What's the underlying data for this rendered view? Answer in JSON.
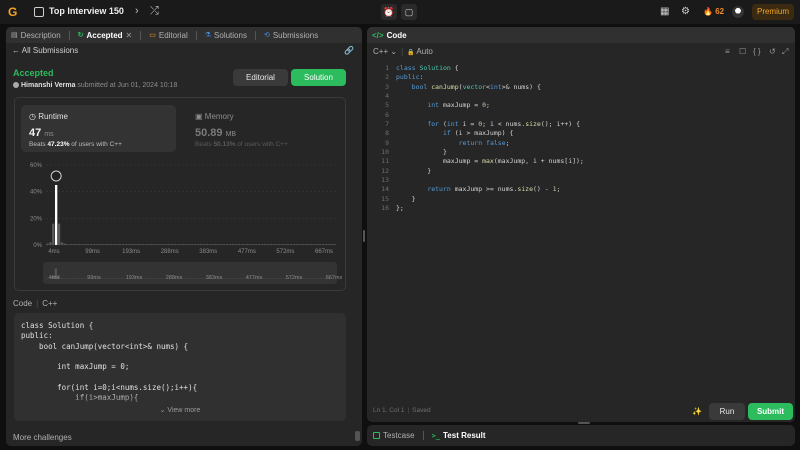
{
  "topbar": {
    "logo_glyph": "G",
    "list_title": "Top Interview 150",
    "prev_glyph": "‹",
    "next_glyph": "›",
    "shuffle_glyph": "⤮",
    "timer_glyph": "⏰",
    "notes_glyph": "▢",
    "layout_glyph": "▦",
    "settings_glyph": "⚙",
    "streak_count": "62",
    "fire_glyph": "🔥",
    "premium_label": "Premium"
  },
  "left_panel": {
    "tabs": [
      {
        "icon": "▤",
        "label": "Description"
      },
      {
        "icon": "↻",
        "label": "Accepted",
        "close": "✕"
      },
      {
        "icon": "▭",
        "label": "Editorial"
      },
      {
        "icon": "⚗",
        "label": "Solutions"
      },
      {
        "icon": "⟲",
        "label": "Submissions"
      }
    ],
    "back_label": "All Submissions",
    "back_glyph": "←",
    "link_glyph": "🔗",
    "status": "Accepted",
    "submitter_name": "Himanshi Verma",
    "submitted_text": " submitted at Jun 01, 2024 10:18",
    "editorial_button": "Editorial",
    "solution_button": "Solution",
    "runtime": {
      "title": "Runtime",
      "value": "47",
      "unit": "ms",
      "beats_prefix": "Beats ",
      "beats_pct": "47.23%",
      "beats_suffix": " of users with C++"
    },
    "memory": {
      "title": "Memory",
      "value": "50.89",
      "unit": "MB",
      "beats_prefix": "Beats ",
      "beats_pct": "50.13%",
      "beats_suffix": " of users with C++"
    },
    "code_label": "Code",
    "code_lang": "C++",
    "code_preview": "class Solution {\npublic:\n    bool canJump(vector<int>& nums) {\n\n        int maxJump = 0;\n\n        for(int i=0;i<nums.size();i++){\n            if(i>maxJump){",
    "view_more": "View more",
    "more_challenges": "More challenges"
  },
  "chart_data": {
    "type": "bar",
    "title": "",
    "ylabel": "",
    "ylim": [
      0,
      60
    ],
    "y_ticks": [
      "0%",
      "20%",
      "40%",
      "60%"
    ],
    "x_ticks": [
      "4ms",
      "99ms",
      "193ms",
      "288ms",
      "383ms",
      "477ms",
      "572ms",
      "667ms"
    ],
    "range_ticks": [
      "4ms",
      "99ms",
      "193ms",
      "288ms",
      "383ms",
      "477ms",
      "572ms",
      "667ms"
    ],
    "bars": [
      1,
      2,
      16,
      45,
      16,
      2,
      1,
      0.6,
      0.6,
      0.6,
      0.6,
      0.6,
      0.6,
      0.6,
      0.6,
      0.6,
      0.6,
      0.6,
      0.6,
      0.6,
      0.6,
      0.6,
      0.6,
      0.6,
      0.6,
      0.6,
      0.6,
      0.6,
      0.6,
      0.6,
      0.6,
      0.6,
      0.6,
      0.6,
      0.6,
      0.6,
      0.6,
      0.6,
      0.6,
      0.6,
      0.6,
      0.6,
      0.6,
      0.6,
      0.6,
      0.6,
      0.6,
      0.6,
      0.6,
      0.6,
      0.6,
      0.6,
      0.6,
      0.6,
      0.6,
      0.6,
      0.6,
      0.6,
      0.6,
      0.6,
      0.6,
      0.6,
      0.6,
      0.6,
      0.6,
      0.6,
      0.6,
      0.6,
      0.6,
      0.6,
      0.6,
      0.6,
      0.6,
      0.6,
      0.6,
      0.6,
      0.6,
      0.6,
      0.6,
      0.6,
      0.6,
      0.6,
      0.6,
      0.6,
      0.6,
      0.6,
      0.6,
      0.6,
      0.6,
      0.6,
      0.6,
      0.6,
      0.6,
      0.6,
      0.6,
      0.6,
      0.6,
      0.6,
      0.6,
      0.6
    ],
    "highlight_index": 3,
    "highlight_color": "#ffffff",
    "bar_color": "#5a5a5a"
  },
  "editor": {
    "title": "Code",
    "title_glyph": "</>",
    "language": "C++",
    "mode": "Auto",
    "lock_glyph": "🔒",
    "tool_glyphs": [
      "≡",
      "☐",
      "{ }",
      "↺",
      "⤢"
    ],
    "line_numbers": [
      "1",
      "2",
      "3",
      "4",
      "5",
      "6",
      "7",
      "8",
      "9",
      "10",
      "11",
      "12",
      "13",
      "14",
      "15",
      "16"
    ],
    "cursor_pos": "Ln 1, Col 1",
    "saved_label": "Saved",
    "run_button": "Run",
    "submit_button": "Submit",
    "bulb_glyph": "✨"
  },
  "bottom_panel": {
    "tabs": [
      "Testcase",
      "Test Result"
    ],
    "prompt_glyph": ">_"
  },
  "colors": {
    "accent_green": "#2cbb5d",
    "premium_orange": "#f5a623",
    "panel_bg": "#262626"
  }
}
